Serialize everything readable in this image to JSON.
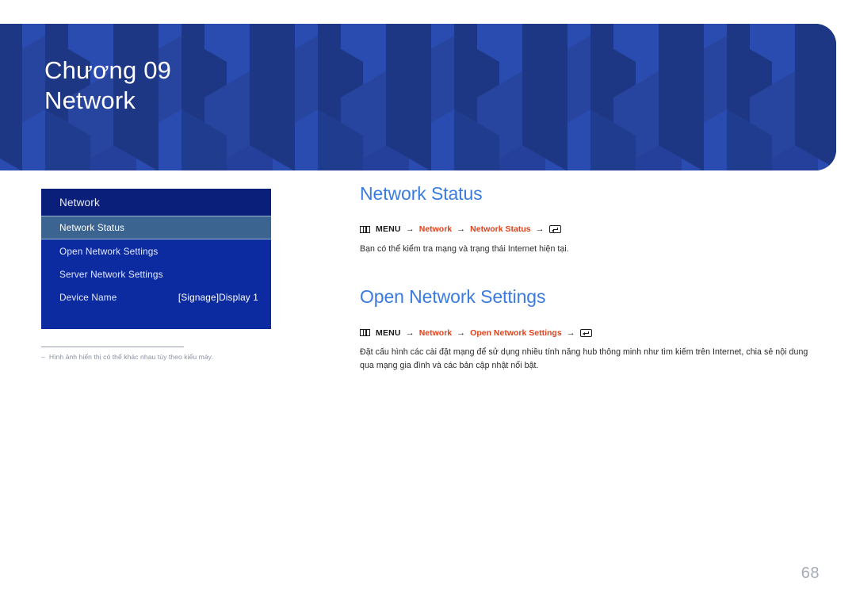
{
  "banner": {
    "chapter_label": "Chương 09",
    "chapter_title": "Network",
    "bg_color": "#24409a",
    "pattern_light": "#2a4bb0",
    "pattern_dark": "#1e3784"
  },
  "osd_menu": {
    "header": "Network",
    "header_bg": "#0a1f7a",
    "body_bg": "#0c2ba0",
    "selected_bg": "#3c6491",
    "rows": [
      {
        "label": "Network Status",
        "value": "",
        "selected": true
      },
      {
        "label": "Open Network Settings",
        "value": "",
        "selected": false
      },
      {
        "label": "Server Network Settings",
        "value": "",
        "selected": false
      },
      {
        "label": "Device Name",
        "value": "[Signage]Display 1",
        "selected": false
      }
    ]
  },
  "footnote": {
    "dash": "‒",
    "text": "Hình ảnh hiển thị có thể khác nhau tùy theo kiểu máy."
  },
  "content": {
    "accent_color": "#3a7be0",
    "link_color": "#e0401a",
    "sections": [
      {
        "title": "Network Status",
        "breadcrumb": {
          "menu_label": "MENU",
          "arrow": "→",
          "link1": "Network",
          "link2": "Network Status"
        },
        "body": "Bạn có thể kiểm tra mạng và trạng thái Internet hiện tại."
      },
      {
        "title": "Open Network Settings",
        "breadcrumb": {
          "menu_label": "MENU",
          "arrow": "→",
          "link1": "Network",
          "link2": "Open Network Settings"
        },
        "body": "Đặt cấu hình các cài đặt mạng để sử dụng nhiều tính năng hub thông minh như tìm kiếm trên Internet, chia sẻ nội dung qua mạng gia đình và các bản cập nhật nổi bật."
      }
    ]
  },
  "page_number": "68"
}
